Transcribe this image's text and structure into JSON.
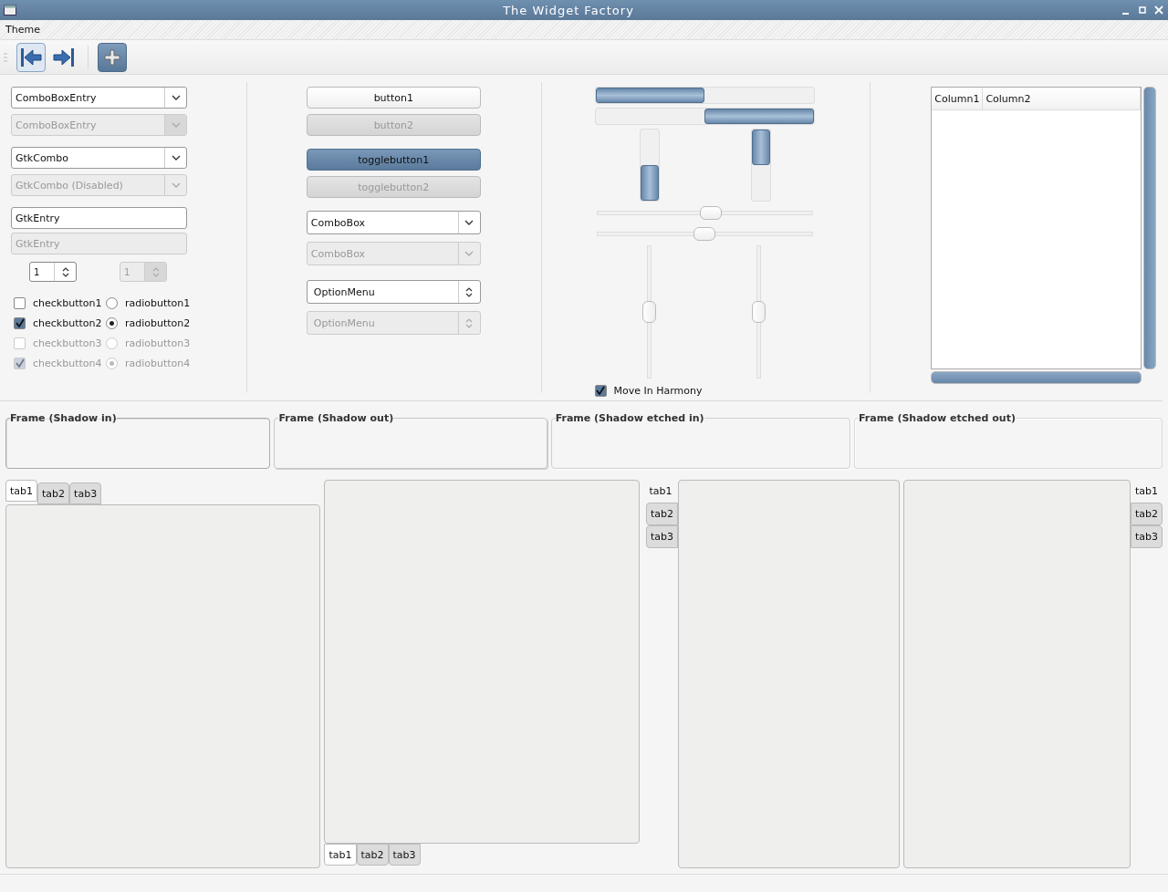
{
  "window": {
    "title": "The Widget Factory"
  },
  "menu": [
    "Theme"
  ],
  "toolbar": [
    {
      "kind": "goto-first",
      "active": false,
      "hover": true
    },
    {
      "kind": "goto-last",
      "active": false,
      "hover": false
    },
    {
      "kind": "add",
      "active": true,
      "hover": false
    }
  ],
  "column1": {
    "combos": [
      {
        "kind": "entry",
        "value": "ComboBoxEntry",
        "disabled": false
      },
      {
        "kind": "entry",
        "value": "ComboBoxEntry",
        "disabled": true
      },
      {
        "kind": "gtkcombo",
        "value": "GtkCombo",
        "disabled": false
      },
      {
        "kind": "gtkcombo",
        "value": "GtkCombo (Disabled)",
        "disabled": true
      }
    ],
    "entries": [
      {
        "value": "GtkEntry",
        "disabled": false
      },
      {
        "value": "GtkEntry",
        "disabled": true
      }
    ],
    "spins": [
      {
        "value": "1",
        "disabled": false
      },
      {
        "value": "1",
        "disabled": true
      }
    ],
    "checks": [
      {
        "label": "checkbutton1",
        "checked": false,
        "disabled": false
      },
      {
        "label": "checkbutton2",
        "checked": true,
        "disabled": false
      },
      {
        "label": "checkbutton3",
        "checked": false,
        "disabled": true
      },
      {
        "label": "checkbutton4",
        "checked": true,
        "disabled": true
      }
    ],
    "radios": [
      {
        "label": "radiobutton1",
        "selected": false,
        "disabled": false
      },
      {
        "label": "radiobutton2",
        "selected": true,
        "disabled": false
      },
      {
        "label": "radiobutton3",
        "selected": false,
        "disabled": true
      },
      {
        "label": "radiobutton4",
        "selected": true,
        "disabled": true
      }
    ]
  },
  "column2": {
    "buttons": [
      {
        "label": "button1",
        "disabled": false
      },
      {
        "label": "button2",
        "disabled": true
      }
    ],
    "toggles": [
      {
        "label": "togglebutton1",
        "on": true,
        "disabled": false
      },
      {
        "label": "togglebutton2",
        "on": false,
        "disabled": true
      }
    ],
    "combo_boxes": [
      {
        "value": "ComboBox",
        "disabled": false
      },
      {
        "value": "ComboBox",
        "disabled": true
      }
    ],
    "option_menus": [
      {
        "value": "OptionMenu",
        "disabled": false
      },
      {
        "value": "OptionMenu",
        "disabled": true
      }
    ]
  },
  "column3": {
    "progress_horizontal": [
      {
        "kind": "left_to_right",
        "level": 0.5
      },
      {
        "kind": "right_to_left",
        "level": 0.5
      }
    ],
    "progress_vertical": [
      {
        "kind": "bottom_to_top",
        "level": 0.5
      },
      {
        "kind": "top_to_bottom",
        "level": 0.5
      }
    ],
    "scales_horizontal": [
      {
        "level": 0.53
      },
      {
        "level": 0.5
      }
    ],
    "scales_vertical": [
      {
        "level": 0.5
      },
      {
        "level": 0.5
      }
    ],
    "harmony": {
      "label": "Move In Harmony",
      "checked": true
    }
  },
  "column4": {
    "columns": [
      "Column1",
      "Column2"
    ]
  },
  "frames": [
    {
      "label": "Frame (Shadow in)",
      "kind": "in"
    },
    {
      "label": "Frame (Shadow out)",
      "kind": "out"
    },
    {
      "label": "Frame (Shadow etched in)",
      "kind": "etched_in"
    },
    {
      "label": "Frame (Shadow etched out)",
      "kind": "etched_out"
    }
  ],
  "notebooks": [
    {
      "kind": "top",
      "tabs": [
        {
          "label": "tab1",
          "selected": true
        },
        {
          "label": "tab2",
          "selected": false
        },
        {
          "label": "tab3",
          "selected": false
        }
      ]
    },
    {
      "kind": "bottom",
      "tabs": [
        {
          "label": "tab1",
          "selected": true
        },
        {
          "label": "tab2",
          "selected": false
        },
        {
          "label": "tab3",
          "selected": false
        }
      ]
    },
    {
      "kind": "left",
      "tabs": [
        {
          "label": "tab1",
          "selected": true
        },
        {
          "label": "tab2",
          "selected": false
        },
        {
          "label": "tab3",
          "selected": false
        }
      ]
    },
    {
      "kind": "right",
      "tabs": [
        {
          "label": "tab1",
          "selected": true
        },
        {
          "label": "tab2",
          "selected": false
        },
        {
          "label": "tab3",
          "selected": false
        }
      ]
    }
  ]
}
